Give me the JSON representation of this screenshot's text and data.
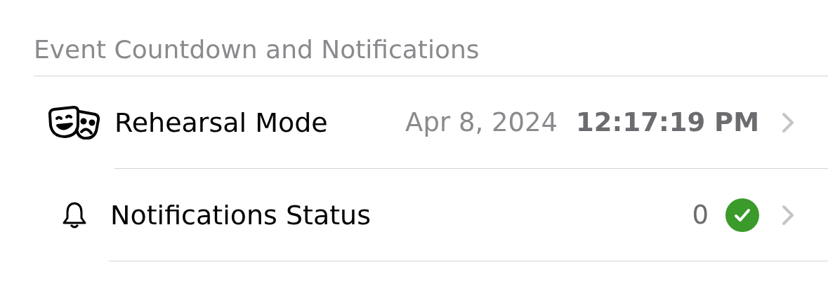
{
  "section": {
    "title": "Event Countdown and Notifications"
  },
  "rows": [
    {
      "kind": "date",
      "label": "Rehearsal Mode",
      "date": "Apr 8, 2024",
      "time": "12:17:19 PM"
    },
    {
      "kind": "status",
      "label": "Notifications Status",
      "count": "0",
      "ok": true
    }
  ]
}
